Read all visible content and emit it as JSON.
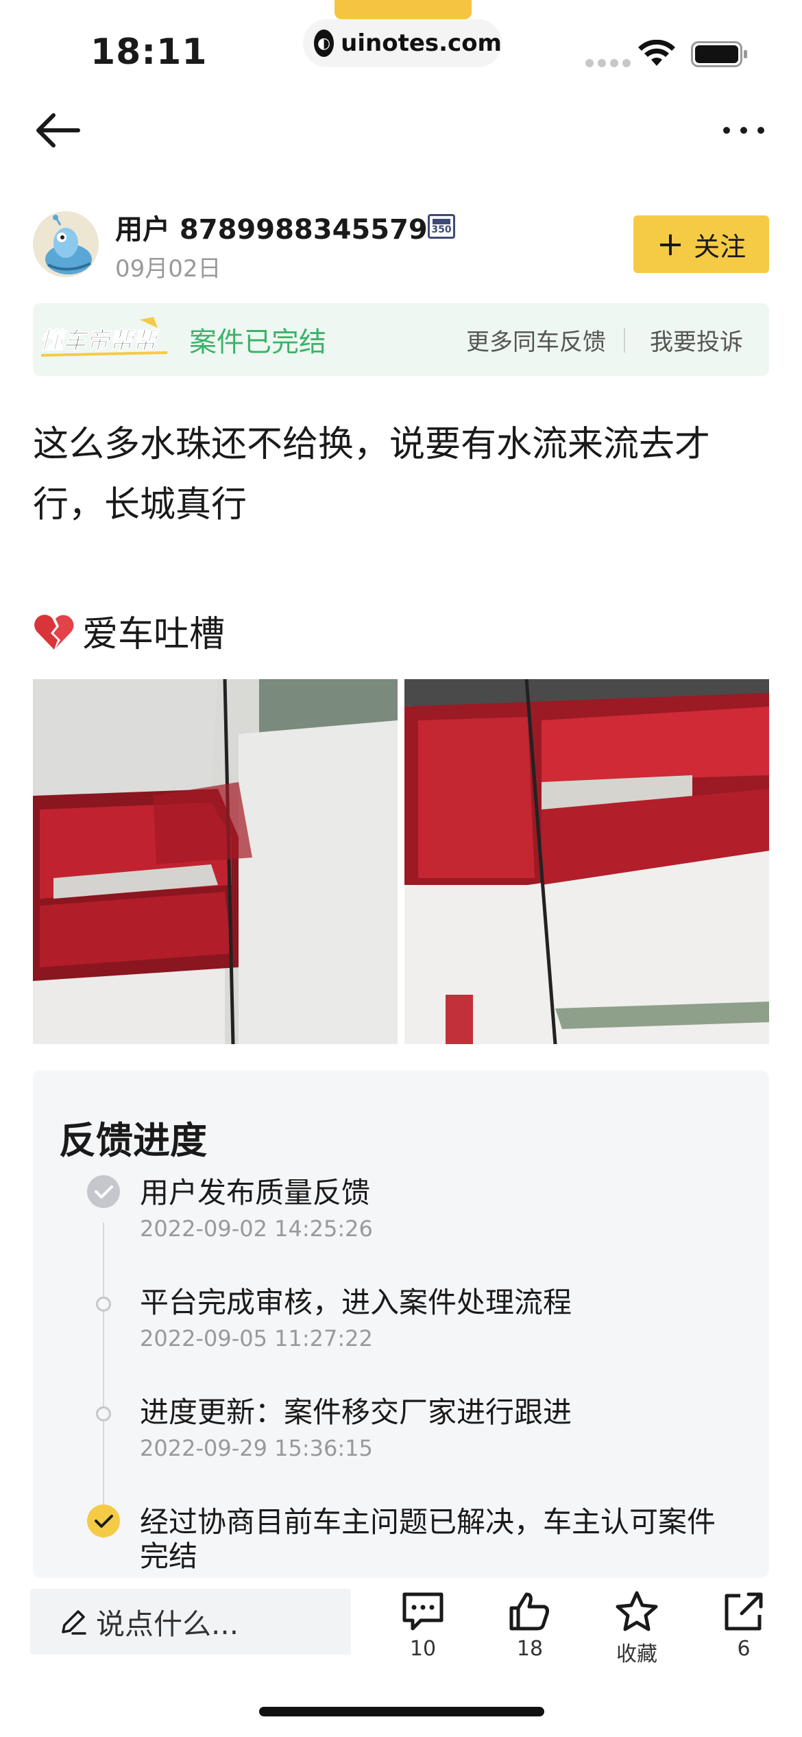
{
  "status_bar": {
    "time": "18:11",
    "url": "uinotes.com"
  },
  "author": {
    "name": "用户 8789988345579",
    "level": "350",
    "date": "09月02日",
    "follow_label": "关注"
  },
  "case_banner": {
    "logo_text": "懂车帝帮帮",
    "status": "案件已完结",
    "more_feedback": "更多同车反馈",
    "complain": "我要投诉"
  },
  "post": {
    "text": "这么多水珠还不给换，说要有水流来流去才行，长城真行",
    "topic": "爱车吐槽"
  },
  "progress": {
    "title": "反馈进度",
    "steps": [
      {
        "title": "用户发布质量反馈",
        "time": "2022-09-02  14:25:26"
      },
      {
        "title": "平台完成审核，进入案件处理流程",
        "time": "2022-09-05  11:27:22"
      },
      {
        "title": "进度更新：案件移交厂家进行跟进",
        "time": "2022-09-29  15:36:15"
      },
      {
        "title": "经过协商目前车主问题已解决，车主认可案件完结",
        "time": ""
      }
    ]
  },
  "bottom_bar": {
    "comment_placeholder": "说点什么...",
    "comments_count": "10",
    "likes_count": "18",
    "favorite_label": "收藏",
    "share_count": "6"
  },
  "colors": {
    "accent_yellow": "#f5cb46",
    "case_green": "#3bb36a",
    "banner_bg": "#eef7f1"
  }
}
